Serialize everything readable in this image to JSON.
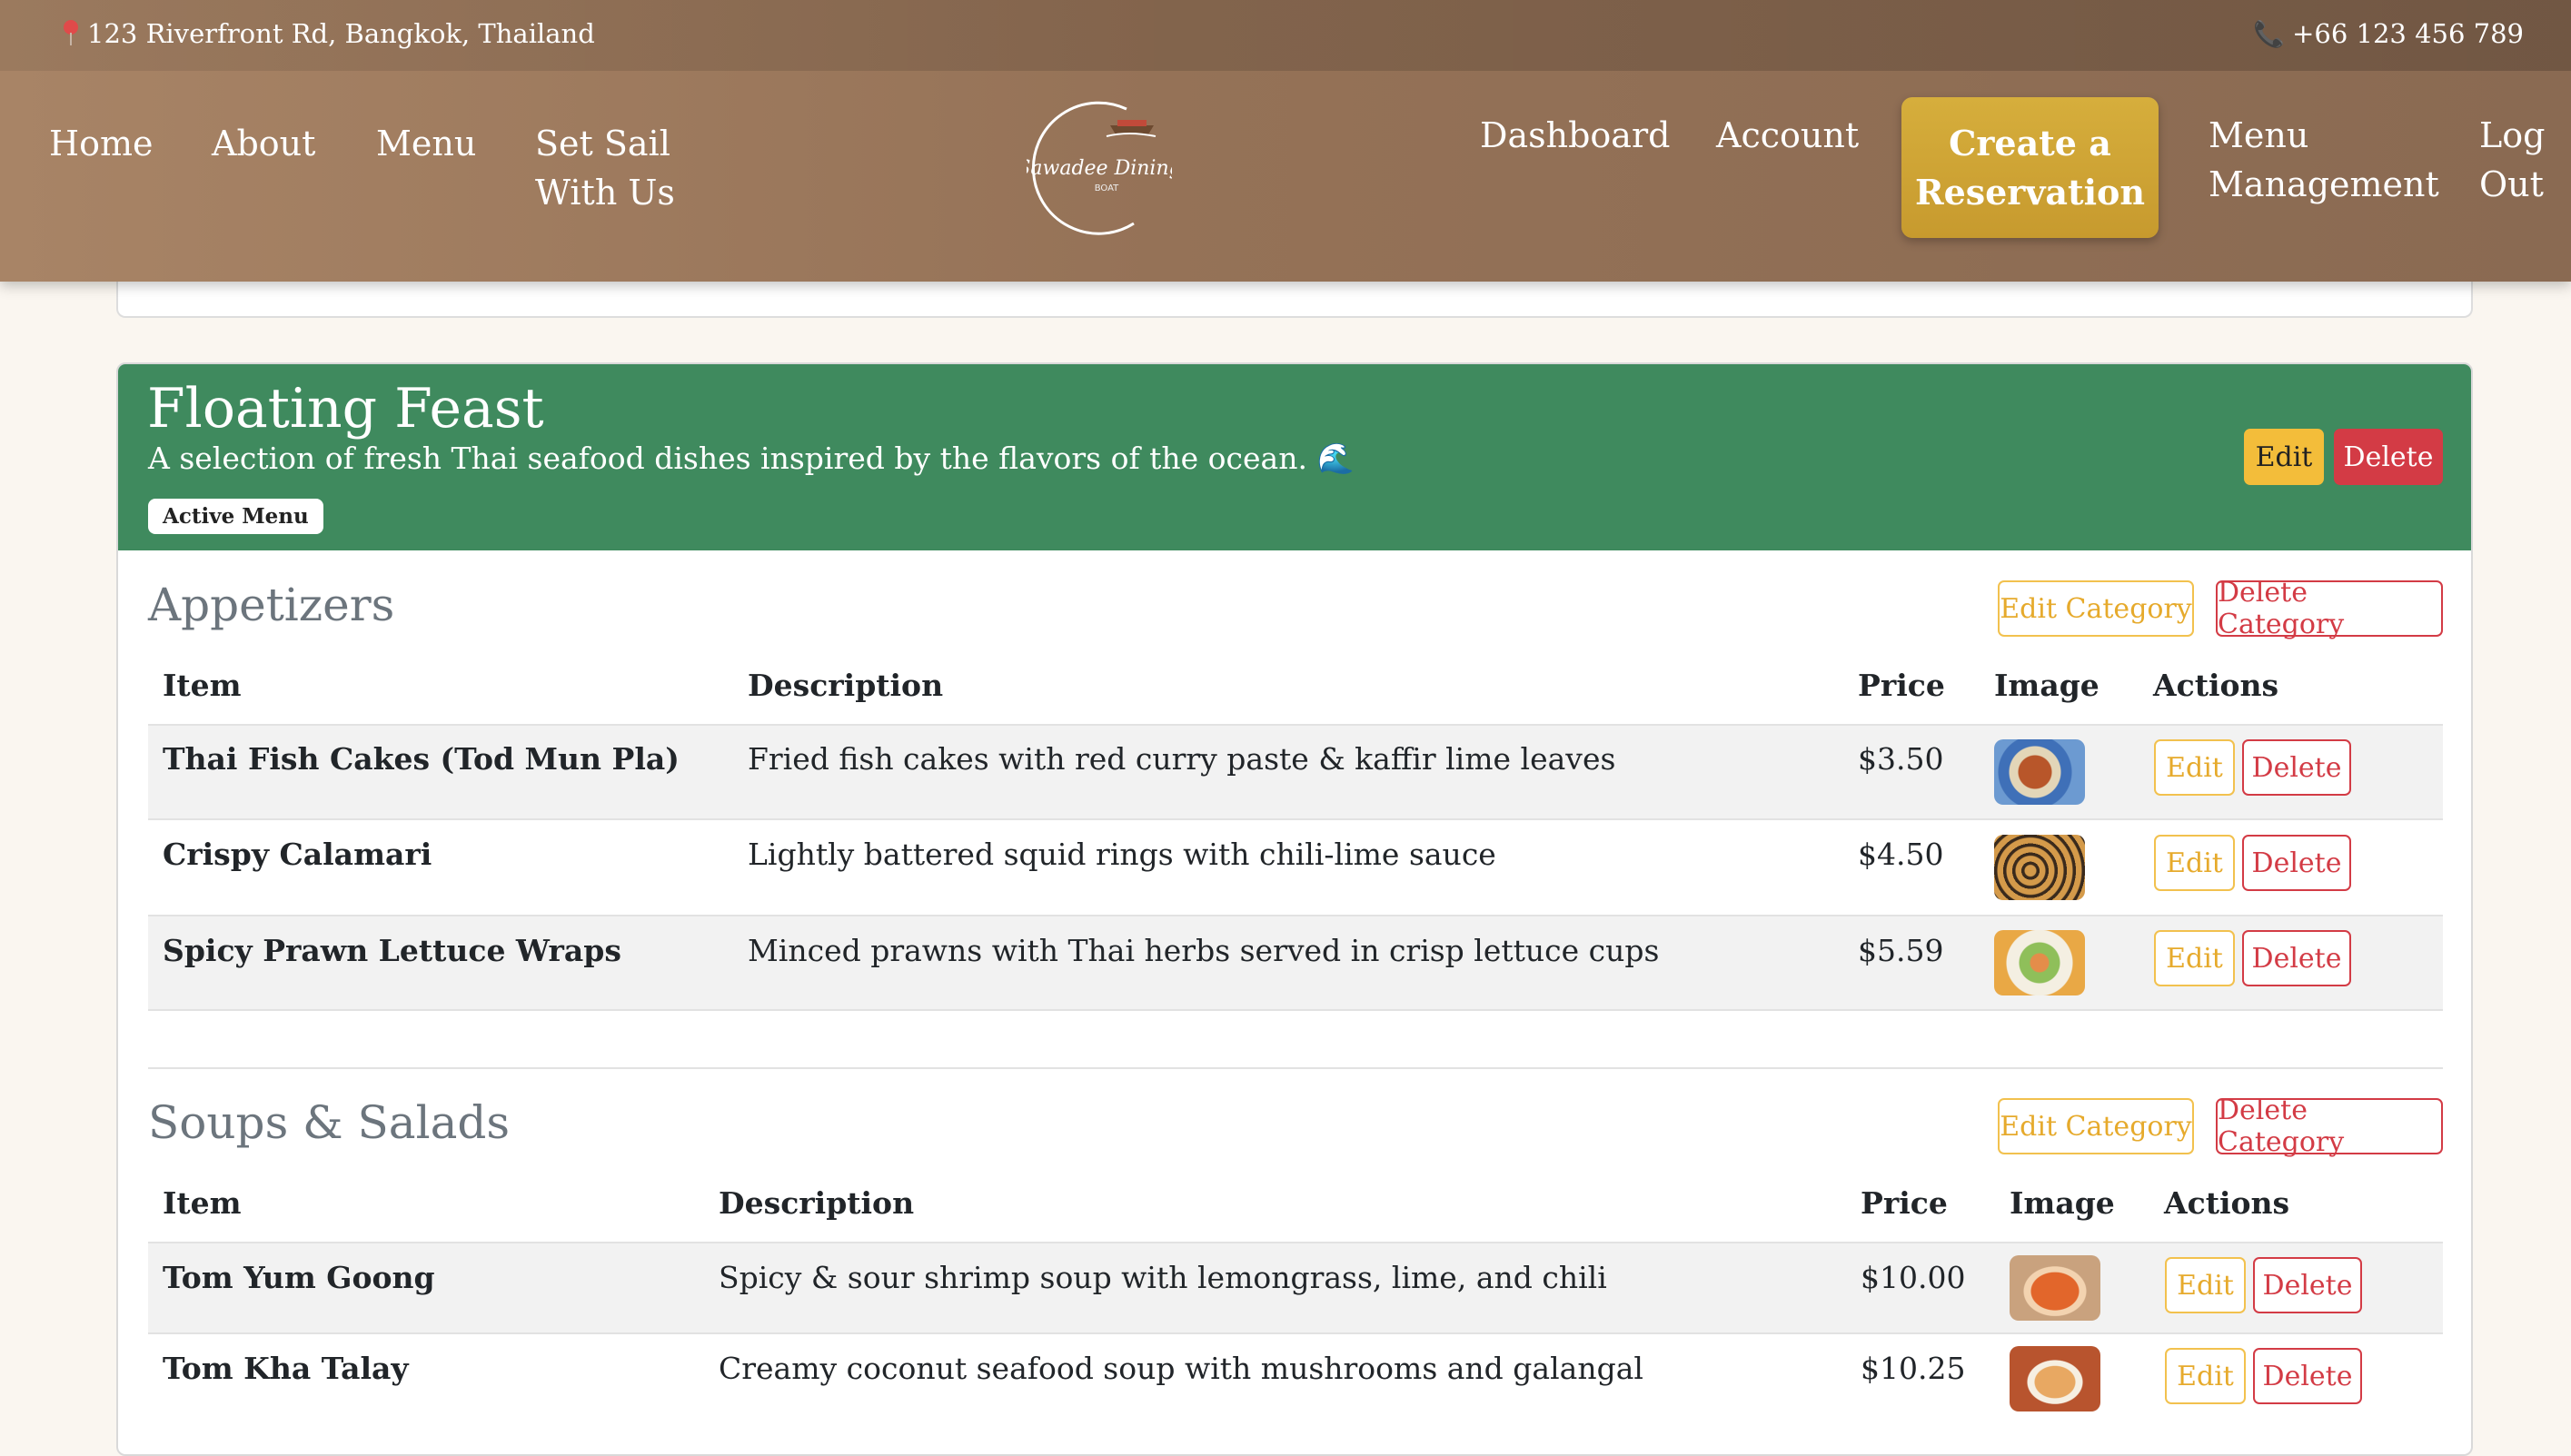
{
  "header": {
    "address": "123 Riverfront Rd, Bangkok, Thailand",
    "phone": "+66 123 456 789",
    "nav_left": [
      "Home",
      "About",
      "Menu",
      "Set Sail With Us"
    ],
    "nav_right": [
      "Dashboard",
      "Account"
    ],
    "cta_label": "Create a Reservation",
    "nav_extra": [
      "Menu Management",
      "Log Out"
    ],
    "logo_text": "Sawadee Dining",
    "logo_sub": "BOAT",
    "icons": {
      "address": "map-pin-icon",
      "phone": "phone-icon"
    }
  },
  "menu": {
    "title": "Floating Feast",
    "description": "A selection of fresh Thai seafood dishes inspired by the flavors of the ocean. 🌊",
    "badge": "Active Menu",
    "edit_label": "Edit",
    "delete_label": "Delete",
    "colors": {
      "header": "#3f8a5e",
      "warning": "#f3bd3a",
      "danger": "#d33b45"
    },
    "categories": [
      {
        "name": "Appetizers",
        "edit_label": "Edit Category",
        "delete_label": "Delete Category",
        "columns": [
          "Item",
          "Description",
          "Price",
          "Image",
          "Actions"
        ],
        "items": [
          {
            "name": "Thai Fish Cakes (Tod Mun Pla)",
            "description": "Fried fish cakes with red curry paste & kaffir lime leaves",
            "price": "$3.50",
            "edit": "Edit",
            "delete": "Delete"
          },
          {
            "name": "Crispy Calamari",
            "description": "Lightly battered squid rings with chili-lime sauce",
            "price": "$4.50",
            "edit": "Edit",
            "delete": "Delete"
          },
          {
            "name": "Spicy Prawn Lettuce Wraps",
            "description": "Minced prawns with Thai herbs served in crisp lettuce cups",
            "price": "$5.59",
            "edit": "Edit",
            "delete": "Delete"
          }
        ]
      },
      {
        "name": "Soups & Salads",
        "edit_label": "Edit Category",
        "delete_label": "Delete Category",
        "columns": [
          "Item",
          "Description",
          "Price",
          "Image",
          "Actions"
        ],
        "items": [
          {
            "name": "Tom Yum Goong",
            "description": "Spicy & sour shrimp soup with lemongrass, lime, and chili",
            "price": "$10.00",
            "edit": "Edit",
            "delete": "Delete"
          },
          {
            "name": "Tom Kha Talay",
            "description": "Creamy coconut seafood soup with mushrooms and galangal",
            "price": "$10.25",
            "edit": "Edit",
            "delete": "Delete"
          }
        ]
      }
    ]
  }
}
